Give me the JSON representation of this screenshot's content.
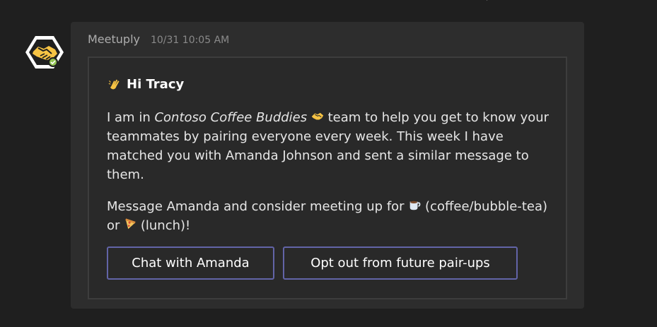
{
  "top_fragment": "/",
  "avatar": {
    "icon": "handshake-icon",
    "status_icon": "check-icon",
    "status_color": "#92c353"
  },
  "message": {
    "sender": "Meetuply",
    "timestamp": "10/31 10:05 AM"
  },
  "card": {
    "greeting_emoji": "waving-hand-icon",
    "greeting_text": "Hi Tracy",
    "para1": {
      "prefix": "I am in ",
      "team_name": "Contoso Coffee Buddies",
      "team_emoji": "handshake-icon",
      "suffix": " team to help you get to know your teammates by pairing everyone every week. This week I have matched you with Amanda Johnson and sent a similar message to them."
    },
    "para2": {
      "prefix": "Message Amanda and consider meeting up for ",
      "coffee_emoji": "coffee-cup-icon",
      "middle": " (coffee/bubble-tea) or ",
      "pizza_emoji": "pizza-icon",
      "suffix": " (lunch)!"
    },
    "buttons": {
      "chat": "Chat with Amanda",
      "opt_out": "Opt out from future pair-ups"
    }
  },
  "colors": {
    "background": "#1f1f1f",
    "bubble": "#2d2d2d",
    "card": "#292929",
    "accent": "#6264a7",
    "avatar": "#f6c344"
  }
}
